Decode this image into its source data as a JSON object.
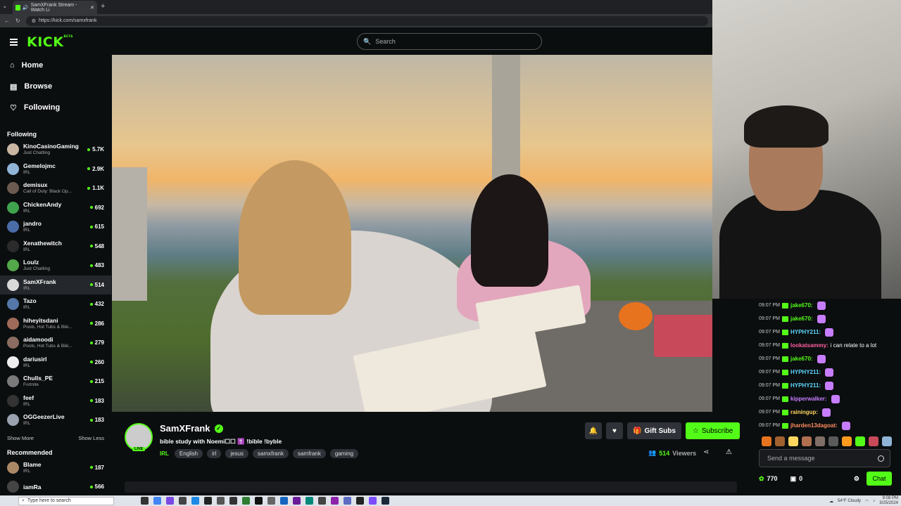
{
  "browser": {
    "tab_title": "SamXFrank Stream - Watch Li",
    "url": "https://kick.com/samxfrank"
  },
  "header": {
    "logo": "KICK",
    "logo_badge": "BETA",
    "search_placeholder": "Search"
  },
  "nav": {
    "home": "Home",
    "browse": "Browse",
    "following": "Following"
  },
  "sidebar": {
    "following_title": "Following",
    "channels": [
      {
        "name": "KinoCasinoGaming",
        "category": "Just Chatting",
        "viewers": "5.7K",
        "color": "#c9b7a3"
      },
      {
        "name": "Gemelojmc",
        "category": "IRL",
        "viewers": "2.9K",
        "color": "#8fb4d6"
      },
      {
        "name": "demisux",
        "category": "Call of Duty: Black Op...",
        "viewers": "1.1K",
        "color": "#6b5a4f"
      },
      {
        "name": "ChickenAndy",
        "category": "IRL",
        "viewers": "692",
        "color": "#3fa34d"
      },
      {
        "name": "jandro",
        "category": "IRL",
        "viewers": "615",
        "color": "#4a6da8"
      },
      {
        "name": "Xenathewitch",
        "category": "IRL",
        "viewers": "548",
        "color": "#2b2b2b"
      },
      {
        "name": "Loulz",
        "category": "Just Chatting",
        "viewers": "483",
        "color": "#53a84a"
      },
      {
        "name": "SamXFrank",
        "category": "IRL",
        "viewers": "514",
        "color": "#d9d9d9"
      },
      {
        "name": "Tazo",
        "category": "IRL",
        "viewers": "432",
        "color": "#5577aa"
      },
      {
        "name": "hiheyitsdani",
        "category": "Pools, Hot Tubs & Biki...",
        "viewers": "286",
        "color": "#a06a5a"
      },
      {
        "name": "aidamoodi",
        "category": "Pools, Hot Tubs & Biki...",
        "viewers": "279",
        "color": "#8a6d60"
      },
      {
        "name": "dariusirl",
        "category": "IRL",
        "viewers": "260",
        "color": "#eeeeee"
      },
      {
        "name": "Chulls_PE",
        "category": "Fortnite",
        "viewers": "215",
        "color": "#7a7a7a"
      },
      {
        "name": "feef",
        "category": "IRL",
        "viewers": "183",
        "color": "#333333"
      },
      {
        "name": "OGGeezerLive",
        "category": "IRL",
        "viewers": "183",
        "color": "#9aa2b0"
      }
    ],
    "show_more": "Show More",
    "show_less": "Show Less",
    "recommended_title": "Recommended",
    "recommended": [
      {
        "name": "Blame",
        "category": "IRL",
        "viewers": "187",
        "color": "#aa8866"
      },
      {
        "name": "iamRa",
        "category": "",
        "viewers": "566",
        "color": "#444444"
      }
    ]
  },
  "stream": {
    "streamer": "SamXFrank",
    "live_badge": "LIVE",
    "title": "bible study with Noemi☐☐ ✝️ !bible !byble",
    "category": "IRL",
    "tags": [
      "English",
      "irl",
      "jesus",
      "samxfrank",
      "samfrank",
      "gaming"
    ],
    "viewers": "514",
    "viewers_label": "Viewers",
    "gift_subs": "Gift Subs",
    "subscribe": "Subscribe"
  },
  "chat": {
    "messages": [
      {
        "time": "09:07 PM",
        "user": "jake670:",
        "text": "",
        "color": "#53fc18",
        "emote": true
      },
      {
        "time": "09:07 PM",
        "user": "jake670:",
        "text": "",
        "color": "#53fc18",
        "emote": true
      },
      {
        "time": "09:07 PM",
        "user": "HYPHY211:",
        "text": "",
        "color": "#5fd7ff",
        "emote": true
      },
      {
        "time": "09:07 PM",
        "user": "lookatsammy:",
        "text": "i can relate to a lot",
        "color": "#ff5fa2",
        "emote": false
      },
      {
        "time": "09:07 PM",
        "user": "jake670:",
        "text": "",
        "color": "#53fc18",
        "emote": true
      },
      {
        "time": "09:07 PM",
        "user": "HYPHY211:",
        "text": "",
        "color": "#5fd7ff",
        "emote": true
      },
      {
        "time": "09:07 PM",
        "user": "HYPHY211:",
        "text": "",
        "color": "#5fd7ff",
        "emote": true
      },
      {
        "time": "09:07 PM",
        "user": "kipperwalker:",
        "text": "",
        "color": "#c77dff",
        "emote": true
      },
      {
        "time": "09:07 PM",
        "user": "rainingup:",
        "text": "",
        "color": "#ffd75f",
        "emote": true
      },
      {
        "time": "09:07 PM",
        "user": "jharden13dagoat:",
        "text": "",
        "color": "#ff8c5f",
        "emote": true
      }
    ],
    "send_placeholder": "Send a message",
    "points": "770",
    "subs_count": "0",
    "chat_button": "Chat"
  },
  "taskbar": {
    "search_placeholder": "Type here to search",
    "weather": "54°F Cloudy",
    "time": "9:08 PM",
    "date": "3/25/2024"
  }
}
